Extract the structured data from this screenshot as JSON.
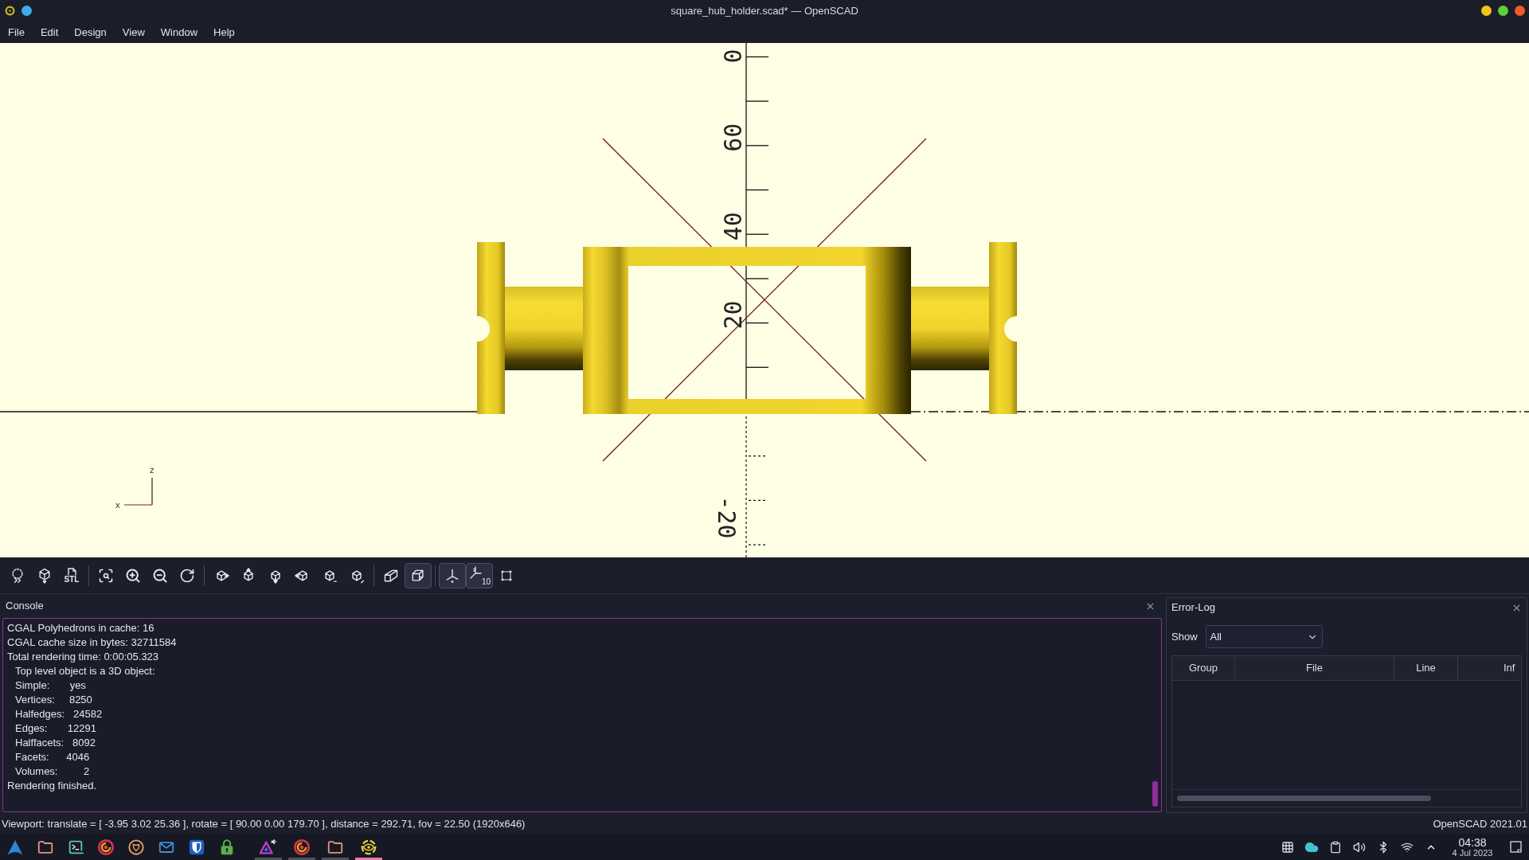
{
  "window": {
    "title": "square_hub_holder.scad* — OpenSCAD"
  },
  "menu": [
    "File",
    "Edit",
    "Design",
    "View",
    "Window",
    "Help"
  ],
  "viewport": {
    "axis_labels": [
      "0",
      "60",
      "40",
      "20",
      "-20"
    ],
    "axis_letters": [
      "z",
      "x"
    ]
  },
  "toolbar": {
    "groups": [
      {
        "items": [
          {
            "kind": "preview",
            "on": false
          },
          {
            "kind": "render",
            "on": false
          },
          {
            "kind": "export_stl",
            "on": false,
            "label": "STL"
          }
        ]
      },
      {
        "items": [
          {
            "kind": "view_all",
            "on": false
          },
          {
            "kind": "zoom_in",
            "on": false
          },
          {
            "kind": "zoom_out",
            "on": false
          },
          {
            "kind": "reset_view",
            "on": false
          }
        ]
      },
      {
        "items": [
          {
            "kind": "view_right",
            "on": false
          },
          {
            "kind": "view_top",
            "on": false
          },
          {
            "kind": "view_bottom",
            "on": false
          },
          {
            "kind": "view_left",
            "on": false
          },
          {
            "kind": "view_front",
            "on": false
          },
          {
            "kind": "view_back",
            "on": false
          }
        ]
      },
      {
        "items": [
          {
            "kind": "perspective",
            "on": false
          },
          {
            "kind": "orthogonal",
            "on": true
          }
        ]
      },
      {
        "items": [
          {
            "kind": "axes",
            "on": true
          },
          {
            "kind": "scale_markers",
            "on": true,
            "label": "10"
          },
          {
            "kind": "edges",
            "on": false
          }
        ]
      }
    ]
  },
  "console": {
    "title": "Console",
    "lines": [
      {
        "text": "CGAL Polyhedrons in cache: 16"
      },
      {
        "text": "CGAL cache size in bytes: 32711584"
      },
      {
        "text": "Total rendering time: 0:00:05.323",
        "children": [
          {
            "text": "Top level object is a 3D object:"
          },
          {
            "text": "Simple:       yes"
          },
          {
            "text": "Vertices:     8250"
          },
          {
            "text": "Halfedges:   24582"
          },
          {
            "text": "Edges:       12291"
          },
          {
            "text": "Halffacets:   8092"
          },
          {
            "text": "Facets:      4046"
          },
          {
            "text": "Volumes:         2"
          }
        ]
      },
      {
        "text": "Rendering finished."
      }
    ]
  },
  "error_log": {
    "title": "Error-Log",
    "filter": {
      "label": "Show",
      "value": "All"
    },
    "columns": [
      "Group",
      "File",
      "Line",
      "Inf"
    ]
  },
  "status_bar": {
    "viewport_info": "Viewport: translate = [ -3.95 3.02 25.36 ], rotate = [ 90.00 0.00 179.70 ], distance = 292.71, fov = 22.50 (1920x646)",
    "version": "OpenSCAD 2021.01"
  },
  "taskbar": {
    "launchers": [
      {
        "kind": "arch"
      },
      {
        "kind": "folder"
      },
      {
        "kind": "terminal"
      },
      {
        "kind": "orb"
      },
      {
        "kind": "emblem"
      },
      {
        "kind": "mail"
      },
      {
        "kind": "shield"
      },
      {
        "kind": "lock"
      }
    ],
    "tasks": [
      {
        "kind": "triangle",
        "selected": false
      },
      {
        "kind": "orb",
        "selected": false
      },
      {
        "kind": "folder",
        "selected": false
      },
      {
        "kind": "ring",
        "selected": true
      }
    ],
    "tray": [
      {
        "kind": "grid"
      },
      {
        "kind": "cloud"
      },
      {
        "kind": "clipboard"
      },
      {
        "kind": "speaker"
      },
      {
        "kind": "bluetooth"
      },
      {
        "kind": "wifi"
      },
      {
        "kind": "expand"
      }
    ],
    "clock": {
      "time": "04:38",
      "date": "4 Jul 2023"
    }
  }
}
